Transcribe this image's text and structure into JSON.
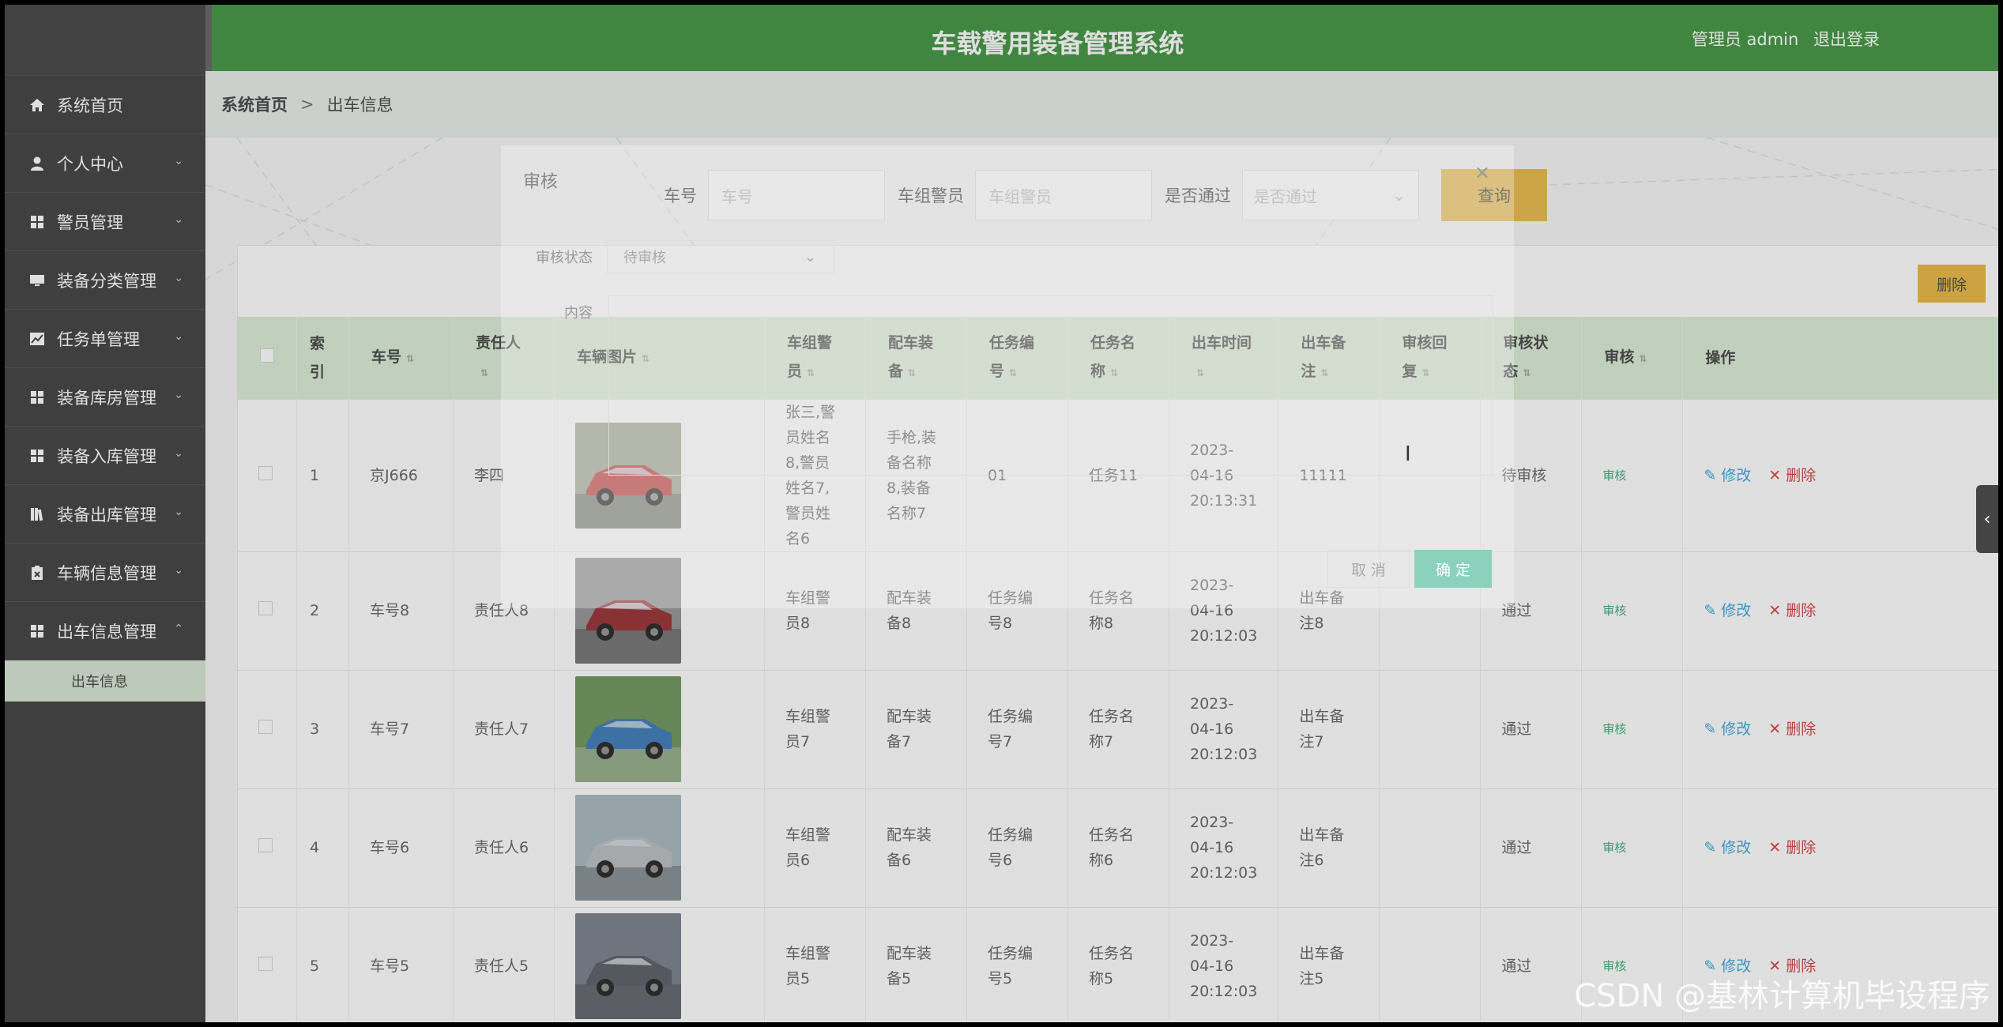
{
  "header": {
    "title": "车载警用装备管理系统",
    "user_role": "管理员 admin",
    "logout": "退出登录"
  },
  "sidebar": {
    "items": [
      {
        "label": "系统首页",
        "icon": "home-icon",
        "chevron": ""
      },
      {
        "label": "个人中心",
        "icon": "user-icon",
        "chevron": "⌄"
      },
      {
        "label": "警员管理",
        "icon": "grid-icon",
        "chevron": "⌄"
      },
      {
        "label": "装备分类管理",
        "icon": "monitor-icon",
        "chevron": "⌄"
      },
      {
        "label": "任务单管理",
        "icon": "chart-icon",
        "chevron": "⌄"
      },
      {
        "label": "装备库房管理",
        "icon": "grid-icon",
        "chevron": "⌄"
      },
      {
        "label": "装备入库管理",
        "icon": "grid-icon",
        "chevron": "⌄"
      },
      {
        "label": "装备出库管理",
        "icon": "book-icon",
        "chevron": "⌄"
      },
      {
        "label": "车辆信息管理",
        "icon": "clipboard-icon",
        "chevron": "⌄"
      },
      {
        "label": "出车信息管理",
        "icon": "grid-icon",
        "chevron": "⌃"
      }
    ],
    "subitem": "出车信息"
  },
  "breadcrumb": {
    "home": "系统首页",
    "separator": ">",
    "current": "出车信息"
  },
  "search": {
    "car_label": "车号",
    "car_placeholder": "车号",
    "officer_label": "车组警员",
    "officer_placeholder": "车组警员",
    "pass_label": "是否通过",
    "pass_placeholder": "是否通过",
    "query_button": "查询"
  },
  "toolbar": {
    "delete_button": "删除"
  },
  "table": {
    "columns": [
      "索引",
      "车号",
      "责任人",
      "车辆图片",
      "车组警员",
      "配车装备",
      "任务编号",
      "任务名称",
      "出车时间",
      "出车备注",
      "审核回复",
      "审核状态",
      "审核",
      "操作"
    ],
    "rows": [
      {
        "idx": "1",
        "car": "京J666",
        "owner": "李四",
        "officers": "张三,警员姓名8,警员姓名7,警员姓名6",
        "equip": "手枪,装备名称8,装备名称7",
        "task_no": "01",
        "task_name": "任务11",
        "time": "2023-04-16 20:13:31",
        "remark": "11111",
        "reply": "",
        "status": "待审核",
        "audit": "审核",
        "img": "red-sedan"
      },
      {
        "idx": "2",
        "car": "车号8",
        "owner": "责任人8",
        "officers": "车组警员8",
        "equip": "配车装备8",
        "task_no": "任务编号8",
        "task_name": "任务名称8",
        "time": "2023-04-16 20:12:03",
        "remark": "出车备注8",
        "reply": "",
        "status": "通过",
        "audit": "审核",
        "img": "red-sportscar"
      },
      {
        "idx": "3",
        "car": "车号7",
        "owner": "责任人7",
        "officers": "车组警员7",
        "equip": "配车装备7",
        "task_no": "任务编号7",
        "task_name": "任务名称7",
        "time": "2023-04-16 20:12:03",
        "remark": "出车备注7",
        "reply": "",
        "status": "通过",
        "audit": "审核",
        "img": "blue-rally"
      },
      {
        "idx": "4",
        "car": "车号6",
        "owner": "责任人6",
        "officers": "车组警员6",
        "equip": "配车装备6",
        "task_no": "任务编号6",
        "task_name": "任务名称6",
        "time": "2023-04-16 20:12:03",
        "remark": "出车备注6",
        "reply": "",
        "status": "通过",
        "audit": "审核",
        "img": "silver-sedan"
      },
      {
        "idx": "5",
        "car": "车号5",
        "owner": "责任人5",
        "officers": "车组警员5",
        "equip": "配车装备5",
        "task_no": "任务编号5",
        "task_name": "任务名称5",
        "time": "2023-04-16 20:12:03",
        "remark": "出车备注5",
        "reply": "",
        "status": "通过",
        "audit": "审核",
        "img": "grey-suv"
      }
    ],
    "edit_label": "修改",
    "delete_label": "删除"
  },
  "dialog": {
    "title": "审核",
    "status_label": "审核状态",
    "status_value": "待审核",
    "content_label": "内容",
    "cancel": "取 消",
    "ok": "确 定"
  },
  "watermark": "CSDN @基林计算机毕设程序"
}
